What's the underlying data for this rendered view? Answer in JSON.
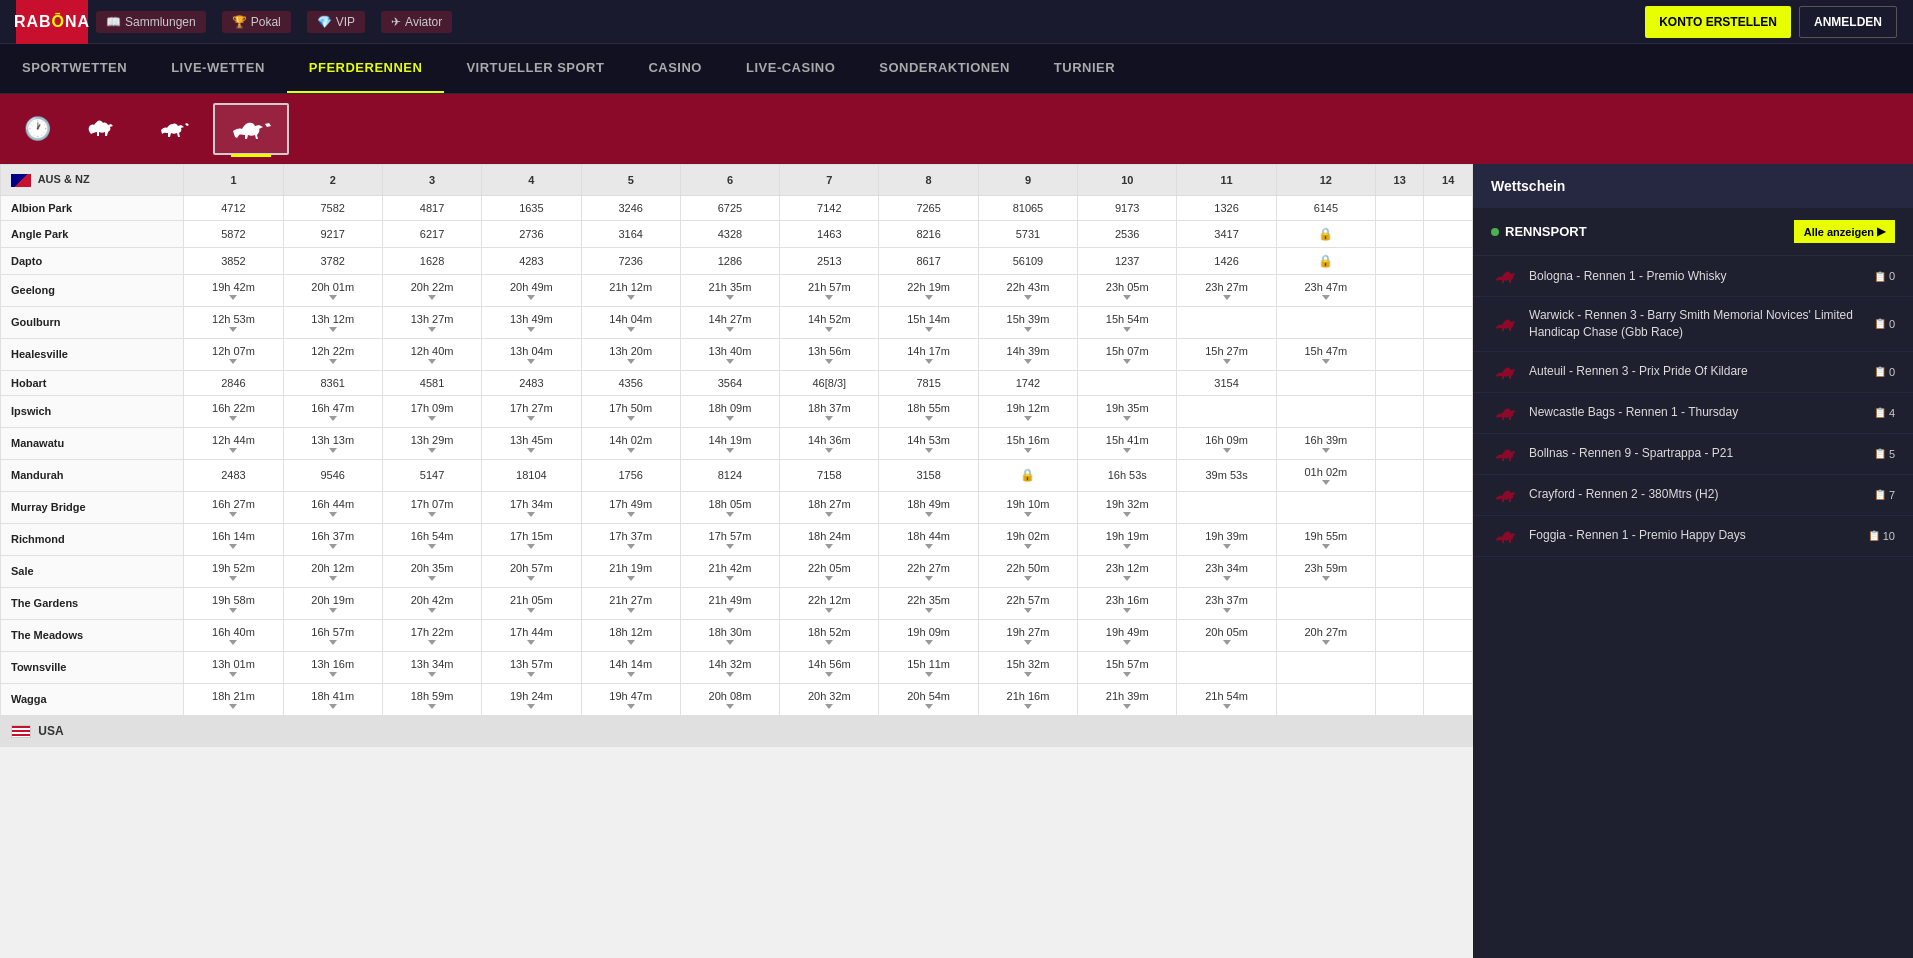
{
  "logo": {
    "text": "RAB",
    "dot": "Ō",
    "text2": "NA"
  },
  "topNav": {
    "links": [
      {
        "icon": "📖",
        "label": "Sammlungen"
      },
      {
        "icon": "🏆",
        "label": "Pokal"
      },
      {
        "icon": "💎",
        "label": "VIP"
      },
      {
        "icon": "✈",
        "label": "Aviator"
      }
    ],
    "btnCreate": "KONTO ERSTELLEN",
    "btnLogin": "ANMELDEN"
  },
  "mainNav": [
    {
      "label": "SPORTWETTEN",
      "active": false
    },
    {
      "label": "LIVE-WETTEN",
      "active": false
    },
    {
      "label": "PFERDERENNEN",
      "active": true
    },
    {
      "label": "VIRTUELLER SPORT",
      "active": false
    },
    {
      "label": "CASINO",
      "active": false
    },
    {
      "label": "LIVE-CASINO",
      "active": false
    },
    {
      "label": "SONDERAKTIONEN",
      "active": false
    },
    {
      "label": "TURNIER",
      "active": false
    }
  ],
  "table": {
    "country1": "AUS & NZ",
    "country2": "USA",
    "columns": [
      "1",
      "2",
      "3",
      "4",
      "5",
      "6",
      "7",
      "8",
      "9",
      "10",
      "11",
      "12",
      "13",
      "14"
    ],
    "rows": [
      {
        "venue": "Albion Park",
        "cols": [
          "4712",
          "7582",
          "4817",
          "1635",
          "3246",
          "6725",
          "7142",
          "7265",
          "81065",
          "9173",
          "1326",
          "6145",
          "",
          ""
        ]
      },
      {
        "venue": "Angle Park",
        "cols": [
          "5872",
          "9217",
          "6217",
          "2736",
          "3164",
          "4328",
          "1463",
          "8216",
          "5731",
          "2536",
          "3417",
          "🔒",
          "",
          ""
        ]
      },
      {
        "venue": "Dapto",
        "cols": [
          "3852",
          "3782",
          "1628",
          "4283",
          "7236",
          "1286",
          "2513",
          "8617",
          "56109",
          "1237",
          "1426",
          "🔒",
          "",
          ""
        ]
      },
      {
        "venue": "Geelong",
        "cols": [
          "19h 42m",
          "20h 01m",
          "20h 22m",
          "20h 49m",
          "21h 12m",
          "21h 35m",
          "21h 57m",
          "22h 19m",
          "22h 43m",
          "23h 05m",
          "23h 27m",
          "23h 47m",
          "",
          ""
        ]
      },
      {
        "venue": "Goulburn",
        "cols": [
          "12h 53m",
          "13h 12m",
          "13h 27m",
          "13h 49m",
          "14h 04m",
          "14h 27m",
          "14h 52m",
          "15h 14m",
          "15h 39m",
          "15h 54m",
          "",
          "",
          "",
          ""
        ]
      },
      {
        "venue": "Healesville",
        "cols": [
          "12h 07m",
          "12h 22m",
          "12h 40m",
          "13h 04m",
          "13h 20m",
          "13h 40m",
          "13h 56m",
          "14h 17m",
          "14h 39m",
          "15h 07m",
          "15h 27m",
          "15h 47m",
          "",
          ""
        ]
      },
      {
        "venue": "Hobart",
        "cols": [
          "2846",
          "8361",
          "4581",
          "2483",
          "4356",
          "3564",
          "46[8/3]",
          "7815",
          "1742",
          "",
          "3154",
          "",
          "",
          ""
        ]
      },
      {
        "venue": "Ipswich",
        "cols": [
          "16h 22m",
          "16h 47m",
          "17h 09m",
          "17h 27m",
          "17h 50m",
          "18h 09m",
          "18h 37m",
          "18h 55m",
          "19h 12m",
          "19h 35m",
          "",
          "",
          "",
          ""
        ]
      },
      {
        "venue": "Manawatu",
        "cols": [
          "12h 44m",
          "13h 13m",
          "13h 29m",
          "13h 45m",
          "14h 02m",
          "14h 19m",
          "14h 36m",
          "14h 53m",
          "15h 16m",
          "15h 41m",
          "16h 09m",
          "16h 39m",
          "",
          ""
        ]
      },
      {
        "venue": "Mandurah",
        "cols": [
          "2483",
          "9546",
          "5147",
          "18104",
          "1756",
          "8124",
          "7158",
          "3158",
          "🔒",
          "16h 53s",
          "39m 53s",
          "01h 02m",
          "",
          ""
        ]
      },
      {
        "venue": "Murray Bridge",
        "cols": [
          "16h 27m",
          "16h 44m",
          "17h 07m",
          "17h 34m",
          "17h 49m",
          "18h 05m",
          "18h 27m",
          "18h 49m",
          "19h 10m",
          "19h 32m",
          "",
          "",
          "",
          ""
        ]
      },
      {
        "venue": "Richmond",
        "cols": [
          "16h 14m",
          "16h 37m",
          "16h 54m",
          "17h 15m",
          "17h 37m",
          "17h 57m",
          "18h 24m",
          "18h 44m",
          "19h 02m",
          "19h 19m",
          "19h 39m",
          "19h 55m",
          "",
          ""
        ]
      },
      {
        "venue": "Sale",
        "cols": [
          "19h 52m",
          "20h 12m",
          "20h 35m",
          "20h 57m",
          "21h 19m",
          "21h 42m",
          "22h 05m",
          "22h 27m",
          "22h 50m",
          "23h 12m",
          "23h 34m",
          "23h 59m",
          "",
          ""
        ]
      },
      {
        "venue": "The Gardens",
        "cols": [
          "19h 58m",
          "20h 19m",
          "20h 42m",
          "21h 05m",
          "21h 27m",
          "21h 49m",
          "22h 12m",
          "22h 35m",
          "22h 57m",
          "23h 16m",
          "23h 37m",
          "",
          "",
          ""
        ]
      },
      {
        "venue": "The Meadows",
        "cols": [
          "16h 40m",
          "16h 57m",
          "17h 22m",
          "17h 44m",
          "18h 12m",
          "18h 30m",
          "18h 52m",
          "19h 09m",
          "19h 27m",
          "19h 49m",
          "20h 05m",
          "20h 27m",
          "",
          ""
        ]
      },
      {
        "venue": "Townsville",
        "cols": [
          "13h 01m",
          "13h 16m",
          "13h 34m",
          "13h 57m",
          "14h 14m",
          "14h 32m",
          "14h 56m",
          "15h 11m",
          "15h 32m",
          "15h 57m",
          "",
          "",
          "",
          ""
        ]
      },
      {
        "venue": "Wagga",
        "cols": [
          "18h 21m",
          "18h 41m",
          "18h 59m",
          "19h 24m",
          "19h 47m",
          "20h 08m",
          "20h 32m",
          "20h 54m",
          "21h 16m",
          "21h 39m",
          "21h 54m",
          "",
          "",
          ""
        ]
      }
    ]
  },
  "rightPanel": {
    "wettschein": "Wettschein",
    "rennsport": "RENNSPORT",
    "alleAnzeigen": "Alle anzeigen",
    "races": [
      {
        "title": "Bologna - Rennen 1 - Premio Whisky",
        "count": "0"
      },
      {
        "title": "Warwick - Rennen 3 - Barry Smith Memorial Novices' Limited Handicap Chase (Gbb Race)",
        "count": "0"
      },
      {
        "title": "Auteuil - Rennen 3 - Prix Pride Of Kildare",
        "count": "0"
      },
      {
        "title": "Newcastle Bags - Rennen 1 - Thursday",
        "count": "4"
      },
      {
        "title": "Bollnas - Rennen 9 - Spartrappa - P21",
        "count": "5"
      },
      {
        "title": "Crayford - Rennen 2 - 380Mtrs (H2)",
        "count": "7"
      },
      {
        "title": "Foggia - Rennen 1 - Premio Happy Days",
        "count": "10"
      }
    ]
  }
}
